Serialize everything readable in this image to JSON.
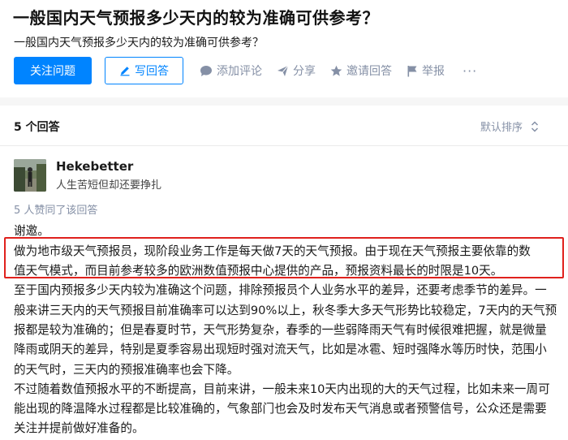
{
  "question": {
    "title": "一般国内天气预报多少天内的较为准确可供参考？",
    "description": "一般国内天气预报多少天内的较为准确可供参考？"
  },
  "actions": {
    "follow_label": "关注问题",
    "write_label": "写回答",
    "comment_label": "添加评论",
    "share_label": "分享",
    "invite_label": "邀请回答",
    "report_label": "举报",
    "more_label": "···"
  },
  "answers": {
    "count_label": "5 个回答",
    "sort_label": "默认排序"
  },
  "answer": {
    "author_name": "Hekebetter",
    "author_bio": "人生苦短但却还要挣扎",
    "votes_label": "5 人赞同了该回答",
    "para1": "谢邀。",
    "para2_line1": "做为地市级天气预报员，现阶段业务工作是每天做7天的天气预报。由于现在天气预报主要依靠的数",
    "para2_line2": "值天气模式，而目前参考较多的欧洲数值预报中心提供的产品，预报资料最长的时限是10天。",
    "para3": "至于国内预报多少天内较为准确这个问题，排除预报员个人业务水平的差异，还要考虑季节的差异。一般来讲三天内的天气预报目前准确率可以达到90%以上，秋冬季大多天气形势比较稳定，7天内的天气预报都是较为准确的；但是春夏时节，天气形势复杂，春季的一些弱降雨天气有时候很难把握，就是微量降雨或阴天的差异，特别是夏季容易出现短时强对流天气，比如是冰雹、短时强降水等历时快，范围小的天气时，三天内的预报准确率也会下降。",
    "para4": "不过随着数值预报水平的不断提高，目前来讲，一般未来10天内出现的大的天气过程，比如未来一周可能出现的降温降水过程都是比较准确的，气象部门也会及时发布天气消息或者预警信号，公众还是需要关注并提前做好准备的。"
  },
  "colors": {
    "primary": "#0084ff",
    "muted": "#8590a6",
    "highlight_box": "#e0211d"
  },
  "icons": [
    "pencil-icon",
    "comment-icon",
    "share-icon",
    "star-icon",
    "flag-icon",
    "more-icon",
    "sort-icon"
  ]
}
